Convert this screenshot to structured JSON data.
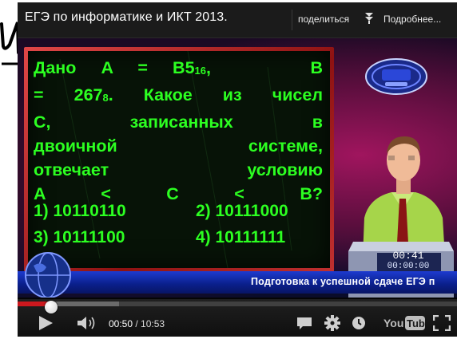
{
  "video_title": "ЕГЭ по информатике и ИКТ 2013.",
  "share_label": "поделиться",
  "more_label": "Подробнее...",
  "board": {
    "lines": [
      "Дано A = B5",
      "= 267",
      "С, записанных в",
      "двоичной системе,",
      "отвечает условию",
      "A < C < B?"
    ],
    "sub1": "16",
    "after_sub1": ",    B",
    "sub2": "8",
    "after_sub2": ". Какое из чисел",
    "options": [
      "1) 10110110",
      "2) 10111000",
      "3) 10111100",
      "4) 10111111"
    ]
  },
  "clock": {
    "elapsed": "00:41",
    "total": "00:00:00"
  },
  "ticker_text": "Подготовка к успешной сдаче ЕГЭ п",
  "player": {
    "current_time": "00:50",
    "separator": " / ",
    "duration": "10:53",
    "played_fraction": 0.077,
    "loaded_fraction": 0.23
  },
  "icons": {
    "play": "play-icon",
    "volume": "volume-icon",
    "captions": "captions-icon",
    "settings": "gear-icon",
    "watch_later": "clock-icon",
    "youtube": "youtube-logo",
    "fullscreen": "fullscreen-icon",
    "more": "arrows-down-icon"
  },
  "colors": {
    "accent": "#cc181e",
    "board_text": "#2cff21",
    "ticker": "#0a1f8a"
  }
}
